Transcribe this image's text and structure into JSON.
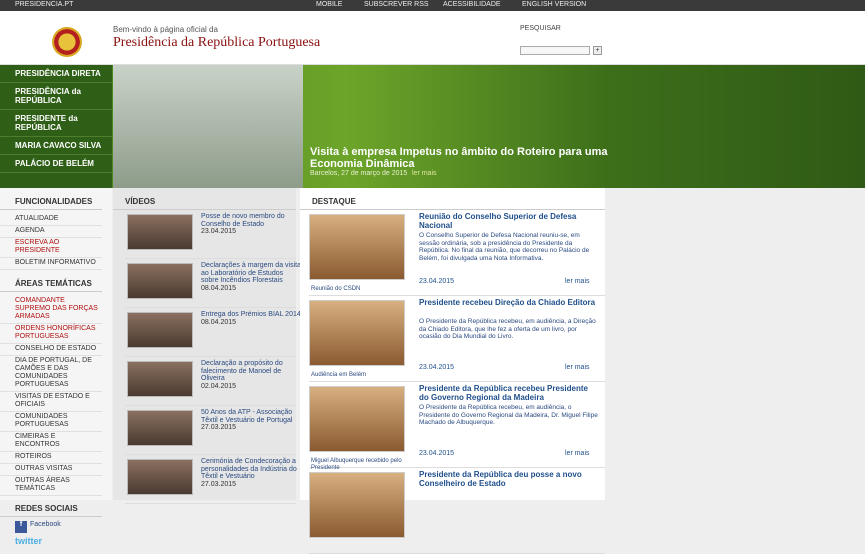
{
  "topbar": {
    "site": "PRESIDENCIA.PT",
    "mobile": "MOBILE",
    "rss": "SUBSCREVER RSS",
    "access": "ACESSIBILIDADE",
    "english": "ENGLISH VERSION"
  },
  "header": {
    "welcome": "Bem-vindo à página oficial da",
    "title": "Presidência da República Portuguesa",
    "search_label": "PESQUISAR"
  },
  "hero": {
    "nav": [
      "PRESIDÊNCIA DIRETA",
      "PRESIDÊNCIA da REPÚBLICA",
      "PRESIDENTE da REPÚBLICA",
      "MARIA CAVACO SILVA",
      "PALÁCIO DE BELÉM"
    ],
    "headline": "Visita à empresa Impetus no âmbito do Roteiro para uma Economia Dinâmica",
    "date": "Barcelos, 27 de março de 2015",
    "more": "ler mais"
  },
  "left": {
    "func_title": "FUNCIONALIDADES",
    "func": [
      "ATUALIDADE",
      "AGENDA",
      "ESCREVA AO PRESIDENTE",
      "BOLETIM INFORMATIVO"
    ],
    "areas_title": "ÁREAS TEMÁTICAS",
    "areas": [
      "COMANDANTE SUPREMO DAS FORÇAS ARMADAS",
      "ORDENS HONORÍFICAS PORTUGUESAS",
      "CONSELHO DE ESTADO",
      "DIA DE PORTUGAL, DE CAMÕES E DAS COMUNIDADES PORTUGUESAS",
      "VISITAS DE ESTADO E OFICIAIS",
      "COMUNIDADES PORTUGUESAS",
      "CIMEIRAS E ENCONTROS",
      "ROTEIROS",
      "OUTRAS VISITAS",
      "OUTRAS ÁREAS TEMÁTICAS"
    ],
    "social_title": "REDES SOCIAIS",
    "facebook": "Facebook",
    "twitter": "twitter"
  },
  "videos": {
    "title": "VÍDEOS",
    "items": [
      {
        "t": "Posse de novo membro do Conselho de Estado",
        "d": "23.04.2015"
      },
      {
        "t": "Declarações à margem da visita ao Laboratório de Estudos sobre Incêndios Florestais",
        "d": "08.04.2015"
      },
      {
        "t": "Entrega dos Prémios BIAL 2014",
        "d": "08.04.2015"
      },
      {
        "t": "Declaração a propósito do falecimento de Manoel de Oliveira",
        "d": "02.04.2015"
      },
      {
        "t": "50 Anos da ATP - Associação Têxtil e Vestuário de Portugal",
        "d": "27.03.2015"
      },
      {
        "t": "Cerimónia de Condecoração a personalidades da Indústria do Têxtil e Vestuário",
        "d": "27.03.2015"
      }
    ]
  },
  "destaque": {
    "title": "DESTAQUE",
    "items": [
      {
        "t": "Reunião do Conselho Superior de Defesa Nacional",
        "x": "O Conselho Superior de Defesa Nacional reuniu-se, em sessão ordinária, sob a presidência do Presidente da República. No final da reunião, que decorreu no Palácio de Belém, foi divulgada uma Nota Informativa.",
        "d": "23.04.2015",
        "c": "Reunião do CSDN",
        "m": "ler mais"
      },
      {
        "t": "Presidente recebeu Direção da Chiado Editora",
        "x": "O Presidente da República recebeu, em audiência, a Direção da Chiado Editora, que lhe fez a oferta de um livro, por ocasião do Dia Mundial do Livro.",
        "d": "23.04.2015",
        "c": "Audiência em Belém",
        "m": "ler mais"
      },
      {
        "t": "Presidente da República recebeu Presidente do Governo Regional da Madeira",
        "x": "O Presidente da República recebeu, em audiência, o Presidente do Governo Regional da Madeira, Dr. Miguel Filipe Machado de Albuquerque.",
        "d": "23.04.2015",
        "c": "Miguel Albuquerque recebido pelo Presidente",
        "m": "ler mais"
      },
      {
        "t": "Presidente da República deu posse a novo Conselheiro de Estado",
        "x": "",
        "d": "",
        "c": "",
        "m": ""
      }
    ]
  }
}
